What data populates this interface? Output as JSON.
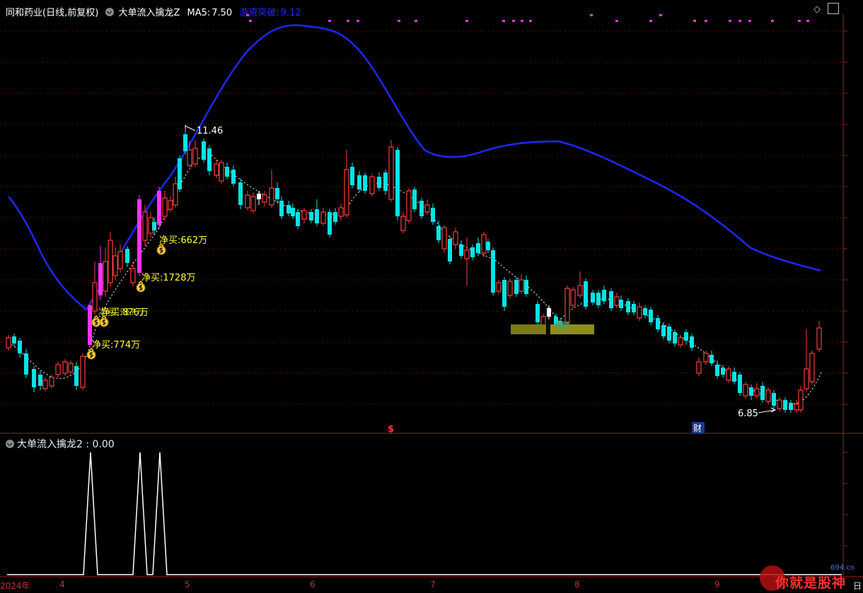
{
  "header": {
    "stock_name": "同和药业",
    "period": "(日线,前复权)",
    "indicator_name": "大单流入擒龙Z",
    "ma5_label": "MA5:",
    "ma5_value": "7.50",
    "breakout_label": "游资突破:",
    "breakout_value": "9.12"
  },
  "corner": {
    "diamond": "◇",
    "restore": "▢"
  },
  "price_annotations": {
    "high": "11.46",
    "low": "6.85"
  },
  "net_buy_labels": [
    "净买:662万",
    "净买:1728万",
    "净买:8?6万",
    "净买:?6?万",
    "净买:774万"
  ],
  "markers": {
    "dollar": "$",
    "finance": "财"
  },
  "indicator_panel": {
    "name": "大单流入擒龙2",
    "sep": ":",
    "value": "0.00"
  },
  "x_axis": {
    "labels": [
      "2024年",
      "4",
      "5",
      "6",
      "7",
      "8",
      "9"
    ],
    "right_label": "日"
  },
  "watermark": {
    "site": "694.cn",
    "text": "你就是股神"
  },
  "colors": {
    "up": "#ff3b3b",
    "down": "#00e5e5",
    "ma": "#1e28ff",
    "magenta": "#ff33ff",
    "net_buy": "#ffff33"
  }
}
